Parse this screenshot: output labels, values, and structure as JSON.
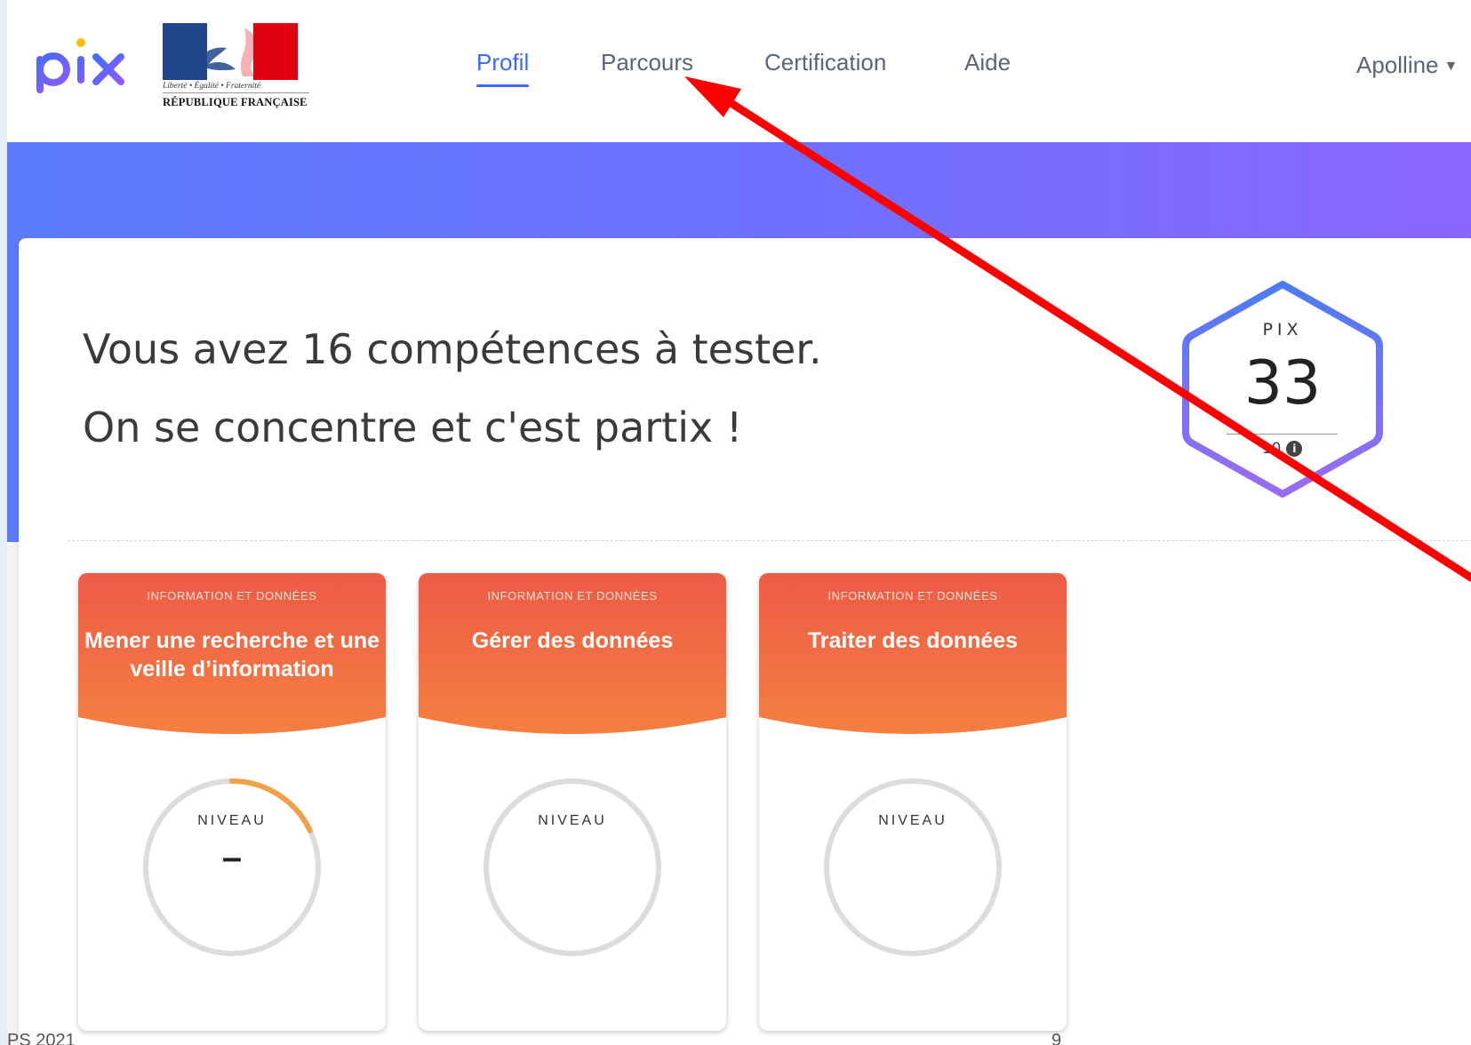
{
  "header": {
    "brand": "pix",
    "logo_rf": {
      "motto": "Liberté • Égalité • Fraternité",
      "name": "RÉPUBLIQUE FRANÇAISE"
    },
    "nav": [
      {
        "label": "Profil",
        "active": true
      },
      {
        "label": "Parcours",
        "active": false
      },
      {
        "label": "Certification",
        "active": false
      },
      {
        "label": "Aide",
        "active": false
      }
    ],
    "user": {
      "name": "Apolline",
      "icon": "caret-down-icon"
    }
  },
  "hero": {
    "line1": "Vous avez 16 compétences à tester.",
    "line2": "On se concentre et c'est partix !"
  },
  "score": {
    "label": "PIX",
    "value": "33",
    "max_partial": "10",
    "info_icon": "info-icon"
  },
  "competences": [
    {
      "domain": "INFORMATION ET DONNÉES",
      "title_lines": [
        "Mener une recherche et une",
        "veille d’information"
      ],
      "level_label": "NIVEAU",
      "level_value": "–",
      "progress": 0.18
    },
    {
      "domain": "INFORMATION ET DONNÉES",
      "title_lines": [
        "Gérer des données"
      ],
      "level_label": "NIVEAU",
      "level_value": "",
      "progress": 0
    },
    {
      "domain": "INFORMATION ET DONNÉES",
      "title_lines": [
        "Traiter des données"
      ],
      "level_label": "NIVEAU",
      "level_value": "",
      "progress": 0
    }
  ],
  "colors": {
    "nav_active": "#3d68ff",
    "nav_text": "#5b6478",
    "banner_start": "#5b7cff",
    "banner_end": "#8a66ff",
    "card_head_top": "#ee5b45",
    "card_head_bottom": "#f48040",
    "gauge_track": "#dcdcdc",
    "gauge_progress": "#f0a046",
    "annotation_arrow": "#ff0000"
  },
  "footer": {
    "left": "PS 2021",
    "right": "9"
  }
}
